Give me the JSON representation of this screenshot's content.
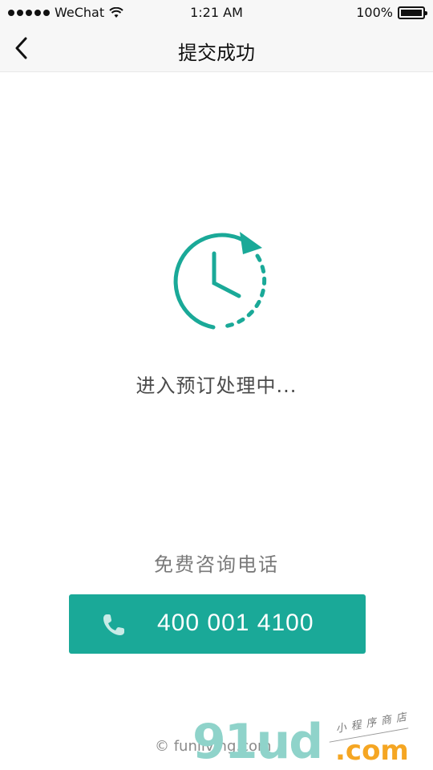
{
  "status_bar": {
    "carrier": "WeChat",
    "time": "1:21 AM",
    "battery": "100%"
  },
  "nav": {
    "title": "提交成功"
  },
  "main": {
    "processing_text": "进入预订处理中...",
    "consult_label": "免费咨询电话",
    "phone_number": "400 001 4100"
  },
  "footer": {
    "copyright": "© funliving.com"
  },
  "watermark": {
    "brand": "91ud",
    "domain": ".com",
    "tagline": "小程序商店"
  },
  "colors": {
    "accent": "#1aa998",
    "nav_bg": "#f7f7f7"
  }
}
